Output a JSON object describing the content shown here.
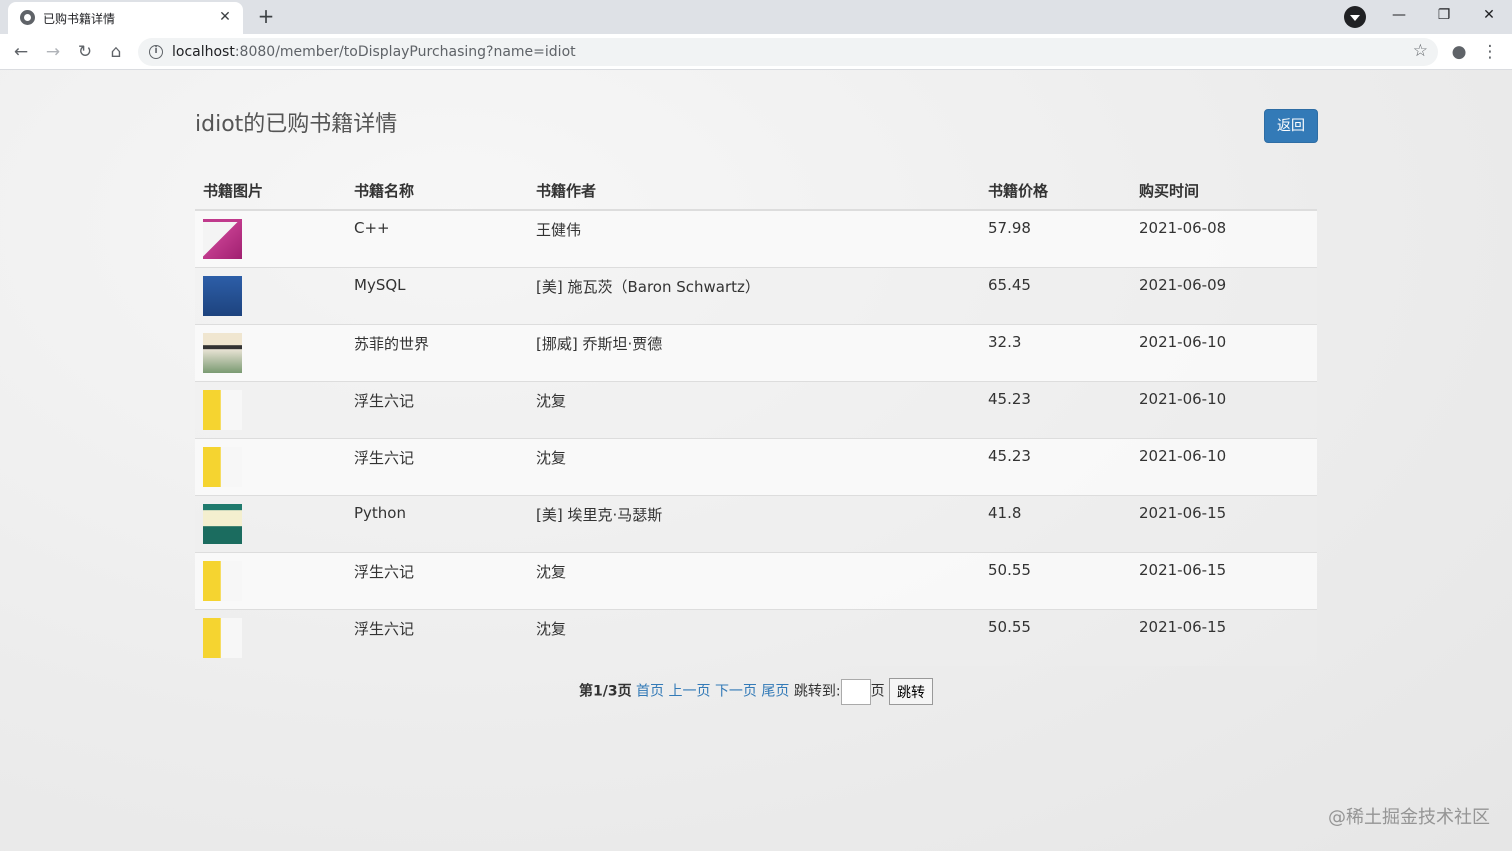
{
  "browser": {
    "tab_title": "已购书籍详情",
    "url_host": "localhost",
    "url_rest": ":8080/member/toDisplayPurchasing?name=idiot"
  },
  "page": {
    "title": "idiot的已购书籍详情",
    "back_label": "返回"
  },
  "table": {
    "headers": [
      "书籍图片",
      "书籍名称",
      "书籍作者",
      "书籍价格",
      "购买时间"
    ],
    "rows": [
      {
        "cover": "cpp-book-cover",
        "name": "C++",
        "author": "王健伟",
        "price": "57.98",
        "date": "2021-06-08"
      },
      {
        "cover": "mysql-book-cover",
        "name": "MySQL",
        "author": "[美] 施瓦茨（Baron Schwartz）",
        "price": "65.45",
        "date": "2021-06-09"
      },
      {
        "cover": "sophie-book-cover",
        "name": "苏菲的世界",
        "author": "[挪威] 乔斯坦·贾德",
        "price": "32.3",
        "date": "2021-06-10"
      },
      {
        "cover": "fusheng-book-cover",
        "name": "浮生六记",
        "author": "沈复",
        "price": "45.23",
        "date": "2021-06-10"
      },
      {
        "cover": "fusheng-book-cover",
        "name": "浮生六记",
        "author": "沈复",
        "price": "45.23",
        "date": "2021-06-10"
      },
      {
        "cover": "python-book-cover",
        "name": "Python",
        "author": "[美] 埃里克·马瑟斯",
        "price": "41.8",
        "date": "2021-06-15"
      },
      {
        "cover": "fusheng-book-cover",
        "name": "浮生六记",
        "author": "沈复",
        "price": "50.55",
        "date": "2021-06-15"
      },
      {
        "cover": "fusheng-book-cover",
        "name": "浮生六记",
        "author": "沈复",
        "price": "50.55",
        "date": "2021-06-15"
      }
    ]
  },
  "pager": {
    "current": "第1/3页",
    "first": "首页",
    "prev": "上一页",
    "next": "下一页",
    "last": "尾页",
    "jump_label": "跳转到:",
    "page_unit": "页",
    "jump_button": "跳转"
  },
  "watermark": "@稀土掘金技术社区"
}
